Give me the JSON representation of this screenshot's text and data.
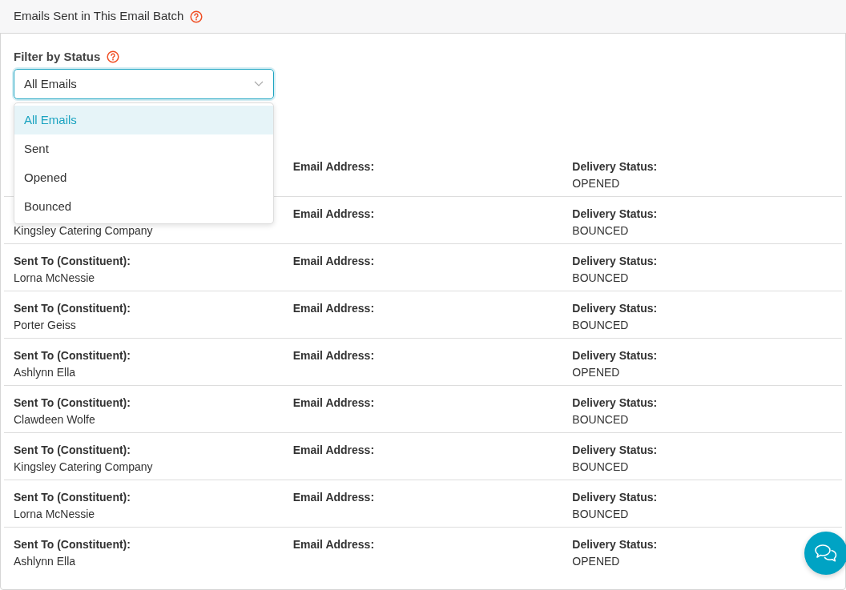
{
  "card": {
    "title": "Emails Sent in This Email Batch"
  },
  "filter": {
    "label": "Filter by Status",
    "value": "All Emails",
    "expanded": true,
    "options": [
      {
        "label": "All Emails",
        "selected": true
      },
      {
        "label": "Sent",
        "selected": false
      },
      {
        "label": "Opened",
        "selected": false
      },
      {
        "label": "Bounced",
        "selected": false
      }
    ]
  },
  "rows": [
    {
      "email_label": "Email Address:",
      "status_label": "Delivery Status:",
      "status": "OPENED"
    },
    {
      "constituent": "Kingsley Catering Company",
      "email_label": "Email Address:",
      "status_label": "Delivery Status:",
      "status": "BOUNCED"
    },
    {
      "constituent_label": "Sent To (Constituent):",
      "constituent": "Lorna McNessie",
      "email_label": "Email Address:",
      "status_label": "Delivery Status:",
      "status": "BOUNCED"
    },
    {
      "constituent_label": "Sent To (Constituent):",
      "constituent": "Porter Geiss",
      "email_label": "Email Address:",
      "status_label": "Delivery Status:",
      "status": "BOUNCED"
    },
    {
      "constituent_label": "Sent To (Constituent):",
      "constituent": "Ashlynn Ella",
      "email_label": "Email Address:",
      "status_label": "Delivery Status:",
      "status": "OPENED"
    },
    {
      "constituent_label": "Sent To (Constituent):",
      "constituent": "Clawdeen Wolfe",
      "email_label": "Email Address:",
      "status_label": "Delivery Status:",
      "status": "BOUNCED"
    },
    {
      "constituent_label": "Sent To (Constituent):",
      "constituent": "Kingsley Catering Company",
      "email_label": "Email Address:",
      "status_label": "Delivery Status:",
      "status": "BOUNCED"
    },
    {
      "constituent_label": "Sent To (Constituent):",
      "constituent": "Lorna McNessie",
      "email_label": "Email Address:",
      "status_label": "Delivery Status:",
      "status": "BOUNCED"
    },
    {
      "constituent_label": "Sent To (Constituent):",
      "constituent": "Ashlynn Ella",
      "email_label": "Email Address:",
      "status_label": "Delivery Status:",
      "status": "OPENED"
    }
  ]
}
